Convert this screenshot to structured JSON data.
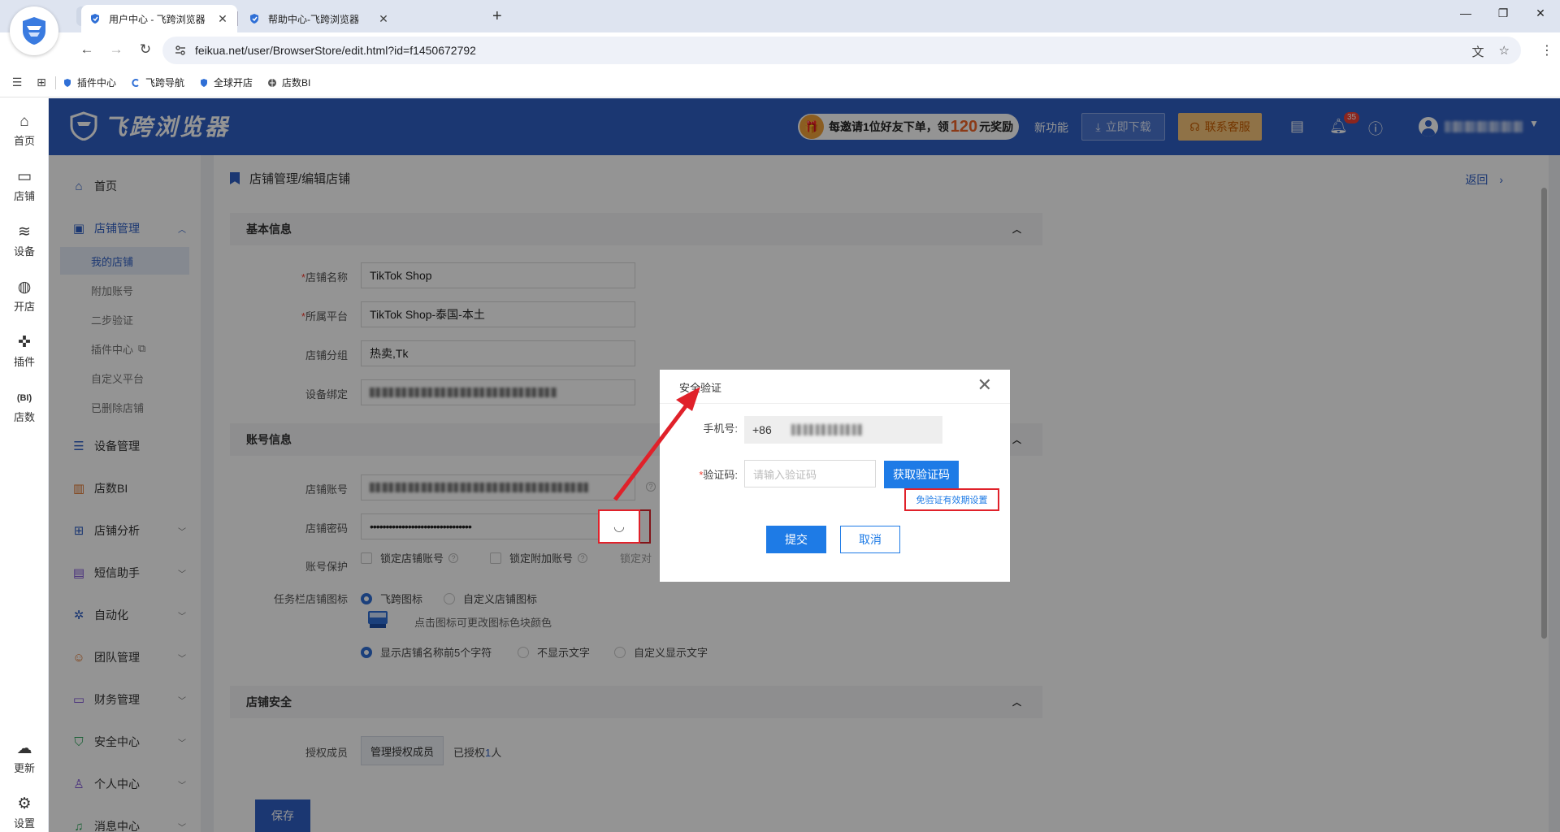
{
  "browser": {
    "tabs": [
      {
        "title": "用户中心 - 飞跨浏览器",
        "active": true
      },
      {
        "title": "帮助中心-飞跨浏览器",
        "active": false
      }
    ],
    "new_tab_label": "+",
    "url": "feikua.net/user/BrowserStore/edit.html?id=f1450672792",
    "bookmarks": [
      "插件中心",
      "飞跨导航",
      "全球开店",
      "店数BI"
    ]
  },
  "header": {
    "logo_text": "飞跨浏览器",
    "promo": {
      "prefix": "每邀请1位好友下单，领",
      "amount": "120",
      "suffix": "元奖励"
    },
    "new_features": "新功能",
    "download_label": "立即下载",
    "service_label": "联系客服",
    "notification_count": "35"
  },
  "rail": [
    {
      "label": "首页",
      "icon": "home-icon"
    },
    {
      "label": "店铺",
      "icon": "store-icon"
    },
    {
      "label": "设备",
      "icon": "layers-icon"
    },
    {
      "label": "开店",
      "icon": "planet-icon"
    },
    {
      "label": "插件",
      "icon": "puzzle-icon"
    },
    {
      "label": "店数",
      "icon": "bi-icon"
    },
    {
      "label": "更新",
      "icon": "cloud-icon"
    },
    {
      "label": "设置",
      "icon": "gear-icon"
    }
  ],
  "sidebar": {
    "home": "首页",
    "store_mgmt": "店铺管理",
    "store_subs": [
      "我的店铺",
      "附加账号",
      "二步验证",
      "插件中心",
      "自定义平台",
      "已删除店铺"
    ],
    "items": [
      "设备管理",
      "店数BI",
      "店铺分析",
      "短信助手",
      "自动化",
      "团队管理",
      "财务管理",
      "安全中心",
      "个人中心",
      "消息中心"
    ]
  },
  "main": {
    "breadcrumb": "店铺管理/编辑店铺",
    "back": "返回",
    "sections": {
      "basic": "基本信息",
      "account": "账号信息",
      "security": "店铺安全"
    },
    "fields": {
      "store_name_label": "店铺名称",
      "store_name_value": "TikTok Shop",
      "platform_label": "所属平台",
      "platform_value": "TikTok Shop-泰国-本土",
      "group_label": "店铺分组",
      "group_value": "热卖,Tk",
      "device_label": "设备绑定",
      "account_label": "店铺账号",
      "password_label": "店铺密码",
      "password_value": "••••••••••••••••••••••••••••••••",
      "protection_label": "账号保护",
      "lock_account": "锁定店铺账号",
      "lock_extra": "锁定附加账号",
      "lock_other": "锁定对",
      "taskbar_label": "任务栏店铺图标",
      "icon_feikua": "飞跨图标",
      "icon_custom": "自定义店铺图标",
      "icon_hint": "点击图标可更改图标色块颜色",
      "show_first5": "显示店铺名称前5个字符",
      "no_text": "不显示文字",
      "custom_text": "自定义显示文字",
      "auth_label": "授权成员",
      "manage_btn": "管理授权成员",
      "authorized_prefix": "已授权",
      "authorized_count": "1",
      "authorized_suffix": "人"
    },
    "save": "保存"
  },
  "modal": {
    "title": "安全验证",
    "phone_label": "手机号:",
    "phone_prefix": "+86",
    "code_label": "验证码:",
    "code_placeholder": "请输入验证码",
    "get_code": "获取验证码",
    "validity_link": "免验证有效期设置",
    "submit": "提交",
    "cancel": "取消"
  },
  "colors": {
    "brand": "#2f5fc4",
    "accent_blue": "#1e7be6",
    "highlight_red": "#e0212a"
  }
}
